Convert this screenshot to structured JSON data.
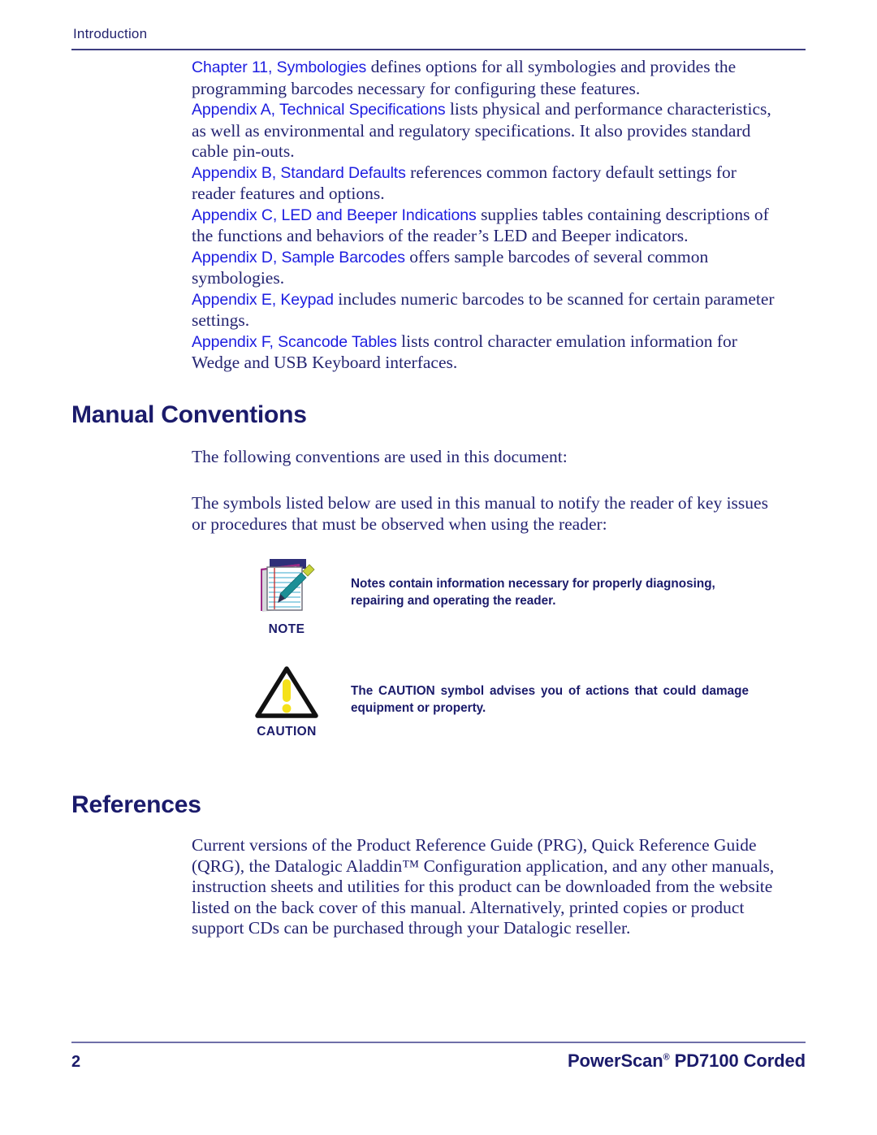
{
  "header": {
    "running_head": "Introduction"
  },
  "colors": {
    "body_text": "#242472",
    "heading": "#1b1b6b",
    "xref_link": "#1d1de0",
    "rule_header": "#3d3d80",
    "rule_footer": "#6f6fa8",
    "caution_yellow": "#f5e11a",
    "caution_outline": "#111111",
    "note_pad_navy": "#2e2e78",
    "note_pad_magenta": "#a02a8a",
    "note_pen_teal": "#1c8f96",
    "note_pen_cap": "#c8d43a",
    "note_rule_cyan": "#4fb9d8",
    "note_margin_red": "#c22a2a"
  },
  "intro_paragraphs": [
    {
      "link": "Chapter 11, Symbologies",
      "text": " defines options for all symbologies and provides the programming barcodes necessary for configuring these features."
    },
    {
      "link": "Appendix A, Technical Specifications",
      "text": " lists physical and performance characteristics, as well as environmental and regulatory specifications. It also provides standard cable pin-outs."
    },
    {
      "link": "Appendix B, Standard Defaults",
      "text": " references common factory default settings for reader features and options."
    },
    {
      "link": "Appendix C, LED and Beeper Indications",
      "text": " supplies tables containing descriptions of the functions and behaviors of the reader’s LED and Beeper indicators."
    },
    {
      "link": "Appendix D, Sample Barcodes",
      "text": " offers sample barcodes of several common symbologies."
    },
    {
      "link": "Appendix E, Keypad",
      "text": " includes numeric barcodes to be scanned for certain parameter settings."
    },
    {
      "link": "Appendix F, Scancode Tables",
      "text": " lists control character emulation information for Wedge and USB Keyboard interfaces."
    }
  ],
  "manual_conventions": {
    "heading": "Manual Conventions",
    "intro": "The following conventions are used in this document:",
    "symbols_intro": "The symbols listed below are used in this manual to notify the reader of key  issues or procedures that must be observed when using the reader:",
    "note": {
      "label": "NOTE",
      "icon": "notepad-pen-icon",
      "text": "Notes contain information necessary for properly diagnosing, repairing and operating the reader."
    },
    "caution": {
      "label": "CAUTION",
      "icon": "warning-triangle-icon",
      "text": "The CAUTION symbol advises you of actions that could damage equipment or property."
    }
  },
  "references": {
    "heading": "References",
    "text": "Current versions of the Product Reference Guide (PRG), Quick Reference Guide (QRG), the Datalogic Aladdin™ Configuration application, and any other manuals, instruction sheets and utilities for this product can be downloaded from the website listed on the back cover of this manual. Alternatively, printed copies or product support CDs can be purchased through your Datalogic reseller."
  },
  "footer": {
    "page_number": "2",
    "product_title_pre": "PowerScan",
    "product_title_sup": "®",
    "product_title_post": " PD7100 Corded"
  }
}
